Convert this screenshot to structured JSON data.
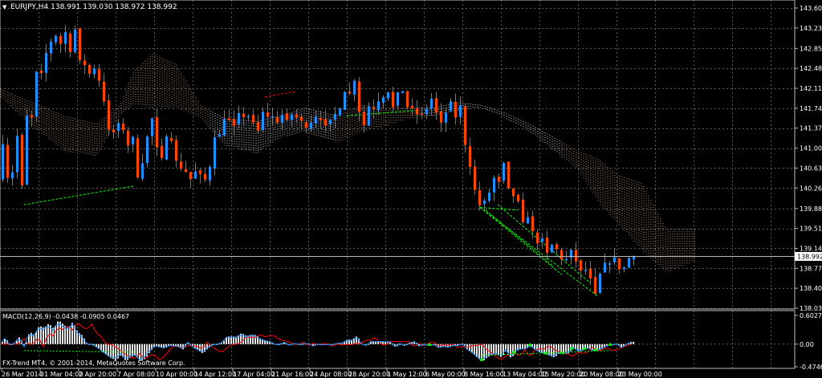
{
  "header": {
    "menu_glyph": "▼",
    "symbol_info": "EURJPY,H4  138.991 139.030 138.972 138.992"
  },
  "main_price_badge": "138.992",
  "macd_label": "MACD(12,26,9) -0.0438 -0.0905 0.0467",
  "copyright": "FX-Trend MT4, © 2001-2014, MetaQuotes Software Corp.",
  "colors": {
    "background": "#000000",
    "grid": "#5a5a5a",
    "bull_candle": "#1e90ff",
    "bear_candle": "#ff4500",
    "cloud": "#d8a88a",
    "cloud_alt": "#ffffff",
    "macd_hist": "#e6e6e6",
    "macd_signal": "#ff0000",
    "macd_line": "#1e90ff",
    "divergence": "#00ff00",
    "text": "#ffffff"
  },
  "chart_data": [
    {
      "type": "candlestick",
      "symbol": "EURJPY",
      "timeframe": "H4",
      "ylim": [
        138.03,
        143.6
      ],
      "y_tick_labels": [
        "143.600",
        "143.230",
        "142.850",
        "142.480",
        "142.110",
        "141.740",
        "141.370",
        "141.000",
        "140.630",
        "140.260",
        "139.880",
        "139.510",
        "139.140",
        "138.770",
        "138.400",
        "138.030"
      ],
      "x_tick_labels": [
        "26 Mar 2014",
        "31 Mar 04:00",
        "2 Apr 20:00",
        "7 Apr 08:00",
        "10 Apr 00:00",
        "14 Apr 12:00",
        "17 Apr 04:00",
        "21 Apr 16:00",
        "24 Apr 08:00",
        "28 Apr 20:00",
        "1 May 12:00",
        "6 May 00:00",
        "8 May 16:00",
        "13 May 04:00",
        "15 May 20:00",
        "20 May 08:00",
        "23 May 00:00"
      ],
      "last_price": 138.992,
      "close_path": [
        [
          0,
          140.45
        ],
        [
          6,
          141.2
        ],
        [
          12,
          140.3
        ],
        [
          18,
          140.6
        ],
        [
          24,
          141.35
        ],
        [
          30,
          140.1
        ],
        [
          36,
          141.9
        ],
        [
          42,
          141.5
        ],
        [
          48,
          142.6
        ],
        [
          54,
          142.35
        ],
        [
          60,
          142.85
        ],
        [
          66,
          143.0
        ],
        [
          72,
          143.1
        ],
        [
          78,
          142.9
        ],
        [
          84,
          143.2
        ],
        [
          90,
          142.7
        ],
        [
          96,
          143.3
        ],
        [
          102,
          142.5
        ],
        [
          108,
          142.55
        ],
        [
          114,
          142.35
        ],
        [
          120,
          142.5
        ],
        [
          126,
          142.2
        ],
        [
          132,
          141.8
        ],
        [
          138,
          141.25
        ],
        [
          144,
          141.3
        ],
        [
          150,
          141.5
        ],
        [
          156,
          141.3
        ],
        [
          162,
          141.0
        ],
        [
          168,
          141.25
        ],
        [
          174,
          140.3
        ],
        [
          180,
          140.8
        ],
        [
          186,
          141.3
        ],
        [
          192,
          141.6
        ],
        [
          198,
          140.9
        ],
        [
          204,
          140.8
        ],
        [
          210,
          141.3
        ],
        [
          216,
          141.1
        ],
        [
          222,
          140.7
        ],
        [
          228,
          140.6
        ],
        [
          234,
          140.55
        ],
        [
          240,
          140.4
        ],
        [
          246,
          140.6
        ],
        [
          252,
          140.5
        ],
        [
          258,
          140.4
        ],
        [
          264,
          140.7
        ],
        [
          270,
          141.3
        ],
        [
          276,
          141.25
        ],
        [
          282,
          141.6
        ],
        [
          288,
          141.5
        ],
        [
          294,
          141.4
        ],
        [
          300,
          141.7
        ],
        [
          306,
          141.55
        ],
        [
          312,
          141.6
        ],
        [
          318,
          141.45
        ],
        [
          324,
          141.3
        ],
        [
          330,
          141.75
        ],
        [
          336,
          141.55
        ],
        [
          342,
          141.6
        ],
        [
          348,
          141.45
        ],
        [
          354,
          141.65
        ],
        [
          360,
          141.5
        ],
        [
          366,
          141.65
        ],
        [
          372,
          141.55
        ],
        [
          378,
          141.5
        ],
        [
          384,
          141.35
        ],
        [
          390,
          141.5
        ],
        [
          396,
          141.6
        ],
        [
          402,
          141.5
        ],
        [
          408,
          141.4
        ],
        [
          414,
          141.55
        ],
        [
          420,
          141.65
        ],
        [
          426,
          141.75
        ],
        [
          432,
          142.1
        ],
        [
          438,
          142.0
        ],
        [
          444,
          142.3
        ],
        [
          450,
          141.55
        ],
        [
          456,
          141.4
        ],
        [
          462,
          141.85
        ],
        [
          468,
          141.7
        ],
        [
          474,
          141.9
        ],
        [
          480,
          141.95
        ],
        [
          486,
          142.05
        ],
        [
          492,
          141.7
        ],
        [
          498,
          142.1
        ],
        [
          504,
          142.05
        ],
        [
          510,
          141.7
        ],
        [
          516,
          141.75
        ],
        [
          522,
          141.6
        ],
        [
          528,
          141.65
        ],
        [
          534,
          141.75
        ],
        [
          540,
          141.95
        ],
        [
          546,
          141.6
        ],
        [
          552,
          141.45
        ],
        [
          558,
          141.7
        ],
        [
          564,
          141.9
        ],
        [
          570,
          141.5
        ],
        [
          576,
          141.85
        ],
        [
          582,
          140.9
        ],
        [
          588,
          140.6
        ],
        [
          594,
          140.15
        ],
        [
          600,
          139.9
        ],
        [
          606,
          140.05
        ],
        [
          612,
          140.2
        ],
        [
          618,
          140.5
        ],
        [
          624,
          140.35
        ],
        [
          630,
          140.8
        ],
        [
          636,
          140.15
        ],
        [
          642,
          140.1
        ],
        [
          648,
          140.0
        ],
        [
          654,
          139.55
        ],
        [
          660,
          139.75
        ],
        [
          666,
          139.4
        ],
        [
          672,
          139.2
        ],
        [
          678,
          139.35
        ],
        [
          684,
          139.0
        ],
        [
          690,
          139.25
        ],
        [
          696,
          139.1
        ],
        [
          702,
          138.9
        ],
        [
          708,
          138.95
        ],
        [
          714,
          139.15
        ],
        [
          720,
          138.85
        ],
        [
          726,
          138.7
        ],
        [
          732,
          138.75
        ],
        [
          738,
          138.55
        ],
        [
          744,
          138.25
        ],
        [
          750,
          138.75
        ],
        [
          756,
          138.9
        ],
        [
          762,
          138.85
        ],
        [
          768,
          139.0
        ],
        [
          774,
          138.7
        ],
        [
          780,
          138.8
        ],
        [
          786,
          138.992
        ]
      ]
    },
    {
      "type": "histogram",
      "name": "MACD(12,26,9)",
      "values": {
        "main": -0.0438,
        "signal": -0.0905,
        "histogram": 0.0467
      },
      "ylim": [
        -0.4746,
        0.6027
      ],
      "y_tick_labels": [
        "0.6027",
        "0.00",
        "-0.4746"
      ]
    }
  ]
}
